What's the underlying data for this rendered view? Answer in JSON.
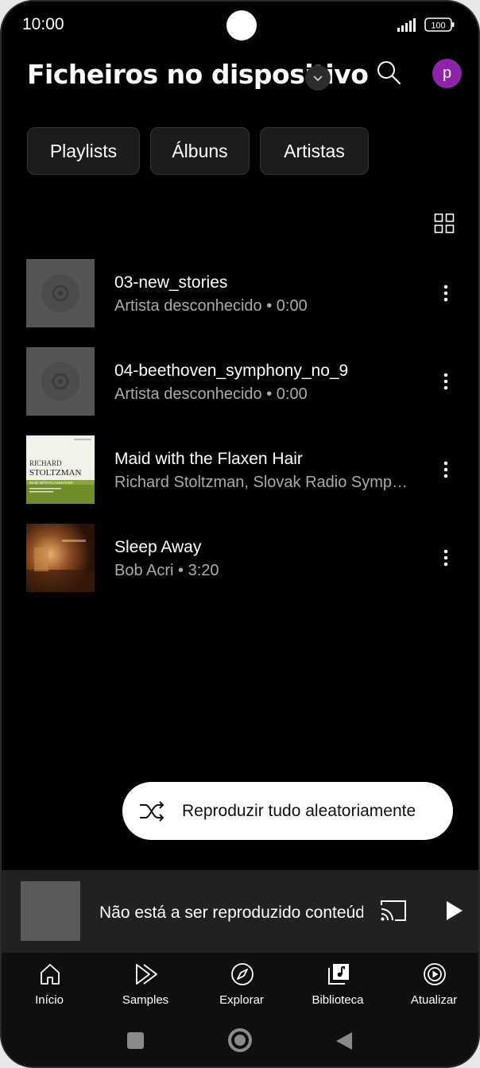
{
  "status_bar": {
    "time": "10:00",
    "battery": "100"
  },
  "header": {
    "title": "Ficheiros no dispositivo",
    "avatar_letter": "p"
  },
  "chips": [
    "Playlists",
    "Álbuns",
    "Artistas"
  ],
  "tracks": [
    {
      "title": "03-new_stories",
      "subtitle": "Artista desconhecido • 0:00",
      "thumb": "placeholder-disc"
    },
    {
      "title": "04-beethoven_symphony_no_9",
      "subtitle": "Artista desconhecido • 0:00",
      "thumb": "placeholder-disc"
    },
    {
      "title": "Maid with the Flaxen Hair",
      "subtitle": "Richard Stoltzman, Slovak Radio Symphony Orchestra",
      "thumb": "album-art-richard-stoltzman"
    },
    {
      "title": "Sleep Away",
      "subtitle": "Bob Acri • 3:20",
      "thumb": "album-art-bob-acri"
    }
  ],
  "album_art_text": {
    "stoltzman_top": "RICHARD",
    "stoltzman_name": "STOLTZMAN",
    "stoltzman_album": "MAID WITH FLAXEN HAIR"
  },
  "shuffle": {
    "label": "Reproduzir tudo aleatoriamente"
  },
  "mini_player": {
    "text": "Não está a ser reproduzido conteúdo"
  },
  "bottom_nav": [
    {
      "label": "Início",
      "icon": "home-icon"
    },
    {
      "label": "Samples",
      "icon": "samples-icon"
    },
    {
      "label": "Explorar",
      "icon": "compass-icon"
    },
    {
      "label": "Biblioteca",
      "icon": "library-icon"
    },
    {
      "label": "Atualizar",
      "icon": "upgrade-icon"
    }
  ],
  "colors": {
    "avatar": "#8e24aa",
    "background": "#000000",
    "mini_player": "#212121"
  }
}
